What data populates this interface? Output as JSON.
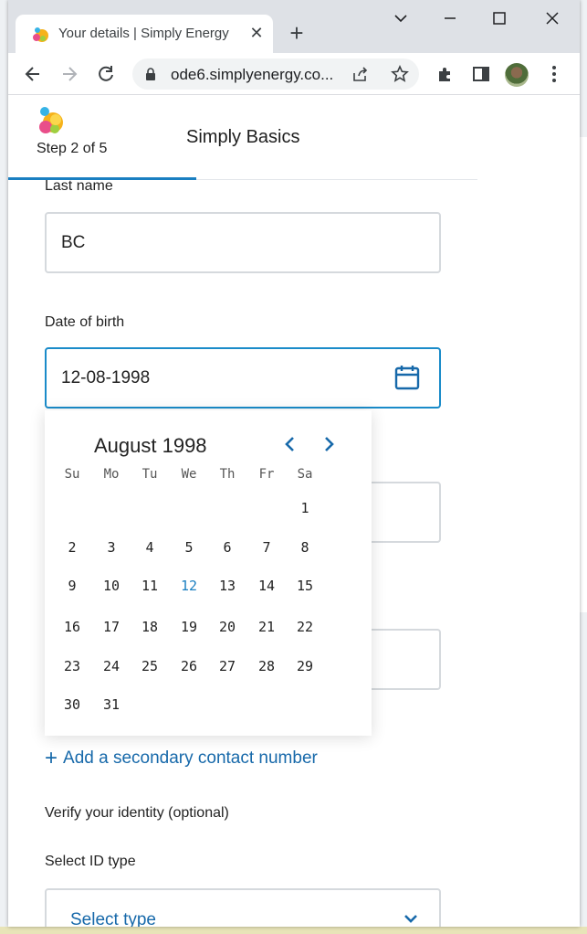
{
  "browser": {
    "tab_title": "Your details | Simply Energy",
    "url": "ode6.simplyenergy.co..."
  },
  "page": {
    "step_label": "Step 2 of 5",
    "plan_title": "Simply Basics",
    "progress_fraction": 0.4
  },
  "form": {
    "last_name_label": "Last name",
    "last_name_value": "BC",
    "dob_label": "Date of birth",
    "dob_value": "12-08-1998",
    "add_secondary_label": "Add a secondary contact number",
    "verify_label": "Verify your identity (optional)",
    "id_type_label": "Select ID type",
    "id_type_value": "Select type"
  },
  "datepicker": {
    "month_year": "August 1998",
    "weekdays": [
      "Su",
      "Mo",
      "Tu",
      "We",
      "Th",
      "Fr",
      "Sa"
    ],
    "weeks": [
      [
        "",
        "",
        "",
        "",
        "",
        "",
        "1"
      ],
      [
        "2",
        "3",
        "4",
        "5",
        "6",
        "7",
        "8"
      ],
      [
        "9",
        "10",
        "11",
        "12",
        "13",
        "14",
        "15"
      ],
      [
        "16",
        "17",
        "18",
        "19",
        "20",
        "21",
        "22"
      ],
      [
        "23",
        "24",
        "25",
        "26",
        "27",
        "28",
        "29"
      ],
      [
        "30",
        "31",
        "",
        "",
        "",
        "",
        ""
      ]
    ],
    "selected_day": "12"
  },
  "colors": {
    "accent": "#1a7fc1",
    "link": "#1769aa",
    "focus_border": "#1a8bc9"
  },
  "icons": [
    "energy-logo-icon",
    "calendar-icon",
    "chevron-left-icon",
    "chevron-right-icon",
    "plus-icon",
    "chevron-down-icon",
    "lock-icon",
    "share-icon",
    "star-icon",
    "extensions-icon",
    "side-panel-icon",
    "menu-dots-icon",
    "back-icon",
    "forward-icon",
    "reload-icon"
  ]
}
